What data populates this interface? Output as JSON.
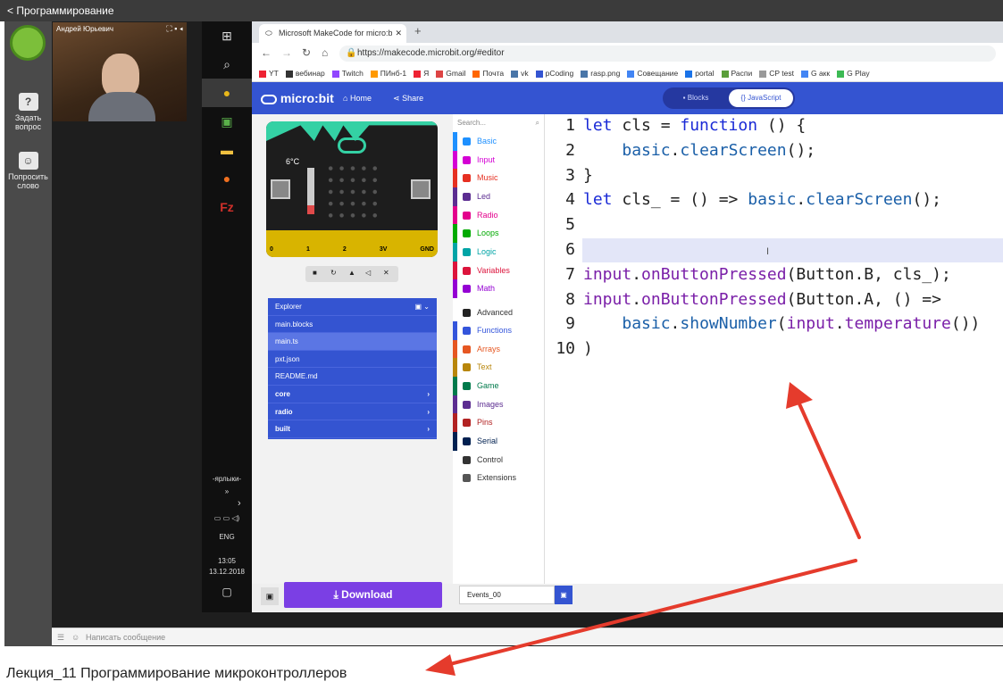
{
  "app": {
    "title": "Программирование"
  },
  "rail": {
    "ask_label": "Задать вопрос",
    "speak_label": "Попросить слово"
  },
  "video": {
    "presenter": "Андрей Юрьевич"
  },
  "taskbar": {
    "shortcuts_label": "-ярлыки-",
    "chevron": "»",
    "lang": "ENG",
    "time": "13:05",
    "date": "13.12.2018"
  },
  "browser": {
    "tab_title": "Microsoft MakeCode for micro:bit",
    "url": "https://makecode.microbit.org/#editor",
    "bookmarks": [
      "YT",
      "вебинар",
      "Twitch",
      "ПИнб-1",
      "Я",
      "Gmail",
      "Почта",
      "vk",
      "pCoding",
      "rasp.png",
      "Совещание",
      "portal",
      "Распи",
      "CP test",
      "G акк",
      "G Play"
    ]
  },
  "makecode": {
    "logo": "micro:bit",
    "home": "Home",
    "share": "Share",
    "blocks_label": "Blocks",
    "js_label": "{} JavaScript",
    "temp_label": "6°C",
    "pins": [
      "0",
      "1",
      "2",
      "3V",
      "GND"
    ],
    "explorer": [
      {
        "label": "Explorer"
      },
      {
        "label": "main.blocks"
      },
      {
        "label": "main.ts"
      },
      {
        "label": "pxt.json"
      },
      {
        "label": "README.md"
      },
      {
        "label": "core"
      },
      {
        "label": "radio"
      },
      {
        "label": "built"
      }
    ],
    "search_placeholder": "Search...",
    "categories": [
      {
        "label": "Basic",
        "color": "#1e90ff"
      },
      {
        "label": "Input",
        "color": "#d400d4"
      },
      {
        "label": "Music",
        "color": "#e63022"
      },
      {
        "label": "Led",
        "color": "#5c2d91"
      },
      {
        "label": "Radio",
        "color": "#e3008c"
      },
      {
        "label": "Loops",
        "color": "#00aa00"
      },
      {
        "label": "Logic",
        "color": "#00a4a6"
      },
      {
        "label": "Variables",
        "color": "#dc143c"
      },
      {
        "label": "Math",
        "color": "#9400d3"
      },
      {
        "label": "Advanced",
        "color": "#222222"
      },
      {
        "label": "Functions",
        "color": "#3455db"
      },
      {
        "label": "Arrays",
        "color": "#e65722"
      },
      {
        "label": "Text",
        "color": "#b8860b"
      },
      {
        "label": "Game",
        "color": "#007a4b"
      },
      {
        "label": "Images",
        "color": "#5c2d91"
      },
      {
        "label": "Pins",
        "color": "#b22222"
      },
      {
        "label": "Serial",
        "color": "#002050"
      },
      {
        "label": "Control",
        "color": "#333333"
      },
      {
        "label": "Extensions",
        "color": "#555555"
      }
    ],
    "code_lines": [
      {
        "n": "1",
        "tokens": [
          [
            "kw",
            "let"
          ],
          [
            "",
            " cls = "
          ],
          [
            "kw",
            "function"
          ],
          [
            "",
            " () {"
          ]
        ]
      },
      {
        "n": "2",
        "tokens": [
          [
            "",
            "    "
          ],
          [
            "fn",
            "basic"
          ],
          [
            "",
            "."
          ],
          [
            "fn",
            "clearScreen"
          ],
          [
            "",
            "();"
          ]
        ]
      },
      {
        "n": "3",
        "tokens": [
          [
            "",
            "}"
          ]
        ]
      },
      {
        "n": "4",
        "tokens": [
          [
            "kw",
            "let"
          ],
          [
            "",
            " cls_ = () => "
          ],
          [
            "fn",
            "basic"
          ],
          [
            "",
            "."
          ],
          [
            "fn",
            "clearScreen"
          ],
          [
            "",
            "();"
          ]
        ]
      },
      {
        "n": "5",
        "tokens": []
      },
      {
        "n": "6",
        "tokens": []
      },
      {
        "n": "7",
        "tokens": [
          [
            "id",
            "input"
          ],
          [
            "",
            "."
          ],
          [
            "id",
            "onButtonPressed"
          ],
          [
            "",
            "(Button.B, cls_);"
          ]
        ]
      },
      {
        "n": "8",
        "tokens": [
          [
            "id",
            "input"
          ],
          [
            "",
            "."
          ],
          [
            "id",
            "onButtonPressed"
          ],
          [
            "",
            "(Button.A, () =>"
          ]
        ]
      },
      {
        "n": "9",
        "tokens": [
          [
            "",
            "    "
          ],
          [
            "fn",
            "basic"
          ],
          [
            "",
            "."
          ],
          [
            "fn",
            "showNumber"
          ],
          [
            "",
            "("
          ],
          [
            "id",
            "input"
          ],
          [
            "",
            "."
          ],
          [
            "id",
            "temperature"
          ],
          [
            "",
            "())"
          ]
        ]
      },
      {
        "n": "10",
        "tokens": [
          [
            "",
            ")"
          ]
        ]
      }
    ],
    "download_label": "Download",
    "project_name": "Events_00"
  },
  "chat": {
    "placeholder": "Написать сообщение"
  },
  "caption": "Лекция_11 Программирование микроконтроллеров",
  "colors": {
    "makecode_blue": "#3454d1",
    "download_purple": "#7b3fe4",
    "arrow_red": "#e53b2c"
  }
}
